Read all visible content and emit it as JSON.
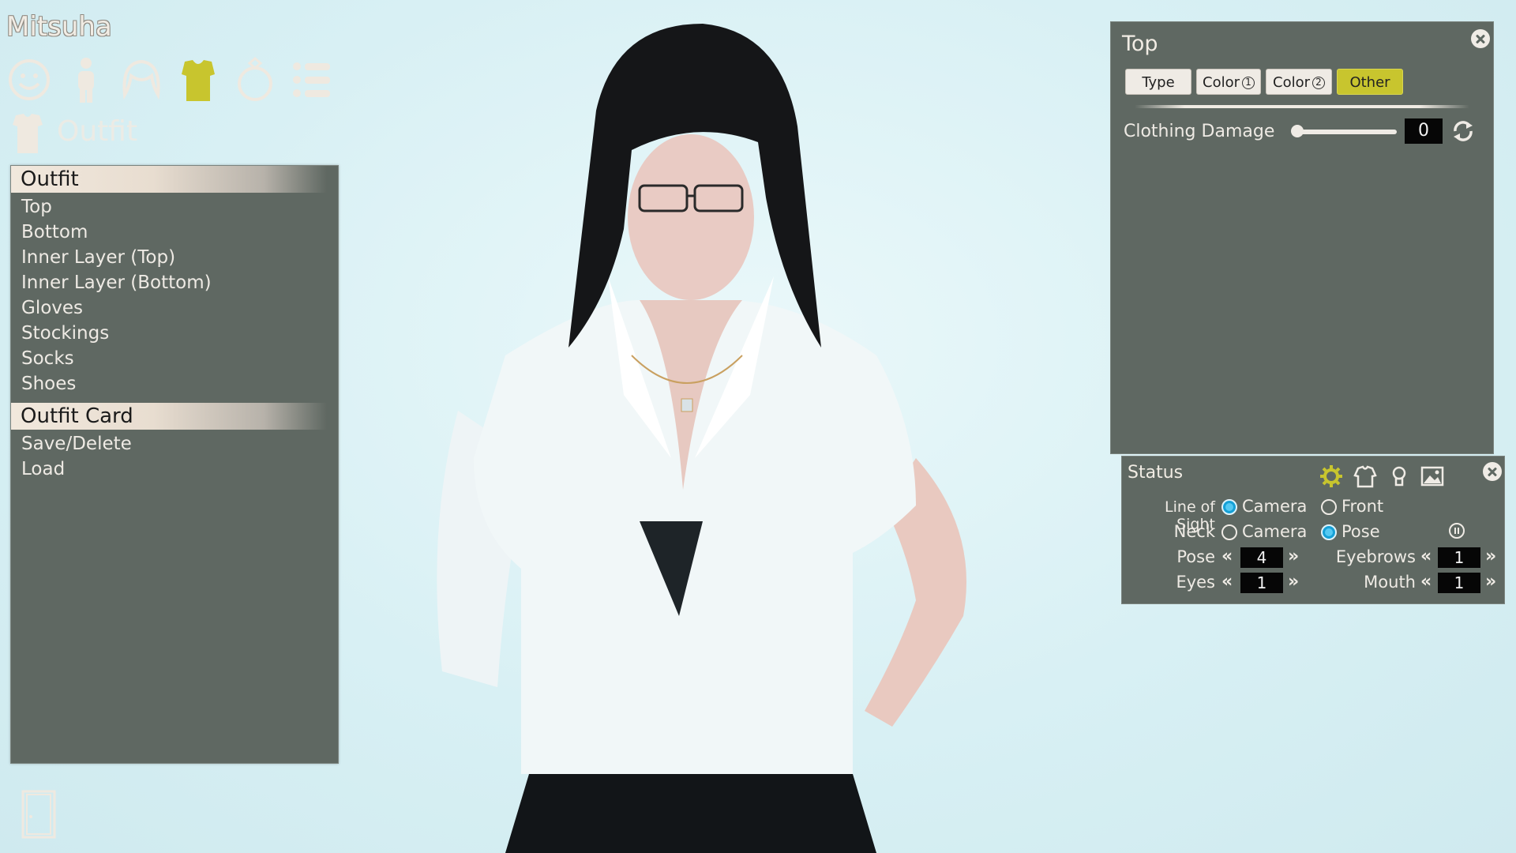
{
  "character_name": "Mitsuha",
  "category_icons": [
    "face-icon",
    "body-icon",
    "hair-icon",
    "outfit-icon",
    "accessory-icon",
    "list-icon"
  ],
  "section": {
    "label": "Outfit"
  },
  "menu": {
    "header1": "Outfit",
    "items1": [
      "Top",
      "Bottom",
      "Inner Layer (Top)",
      "Inner Layer (Bottom)",
      "Gloves",
      "Stockings",
      "Socks",
      "Shoes"
    ],
    "header2": "Outfit Card",
    "items2": [
      "Save/Delete",
      "Load"
    ]
  },
  "top_panel": {
    "title": "Top",
    "tabs": [
      "Type",
      "Color",
      "Color",
      "Other"
    ],
    "tab_nums": [
      "1",
      "2"
    ],
    "active_tab": "Other",
    "clothing_damage_label": "Clothing Damage",
    "clothing_damage_value": "0",
    "clothing_damage_level": 0
  },
  "status_panel": {
    "title": "Status",
    "line_of_sight_label": "Line of Sight",
    "neck_label": "Neck",
    "opt_camera": "Camera",
    "opt_front": "Front",
    "opt_pose": "Pose",
    "pose_label": "Pose",
    "pose_value": "4",
    "eyes_label": "Eyes",
    "eyes_value": "1",
    "eyebrows_label": "Eyebrows",
    "eyebrows_value": "1",
    "mouth_label": "Mouth",
    "mouth_value": "1",
    "line_of_sight_selected": "Camera",
    "neck_selected": "Pose"
  },
  "colors": {
    "panel_bg": "#5f6862",
    "accent_yellow": "#c8c52e",
    "radio_blue": "#16a0d6"
  }
}
